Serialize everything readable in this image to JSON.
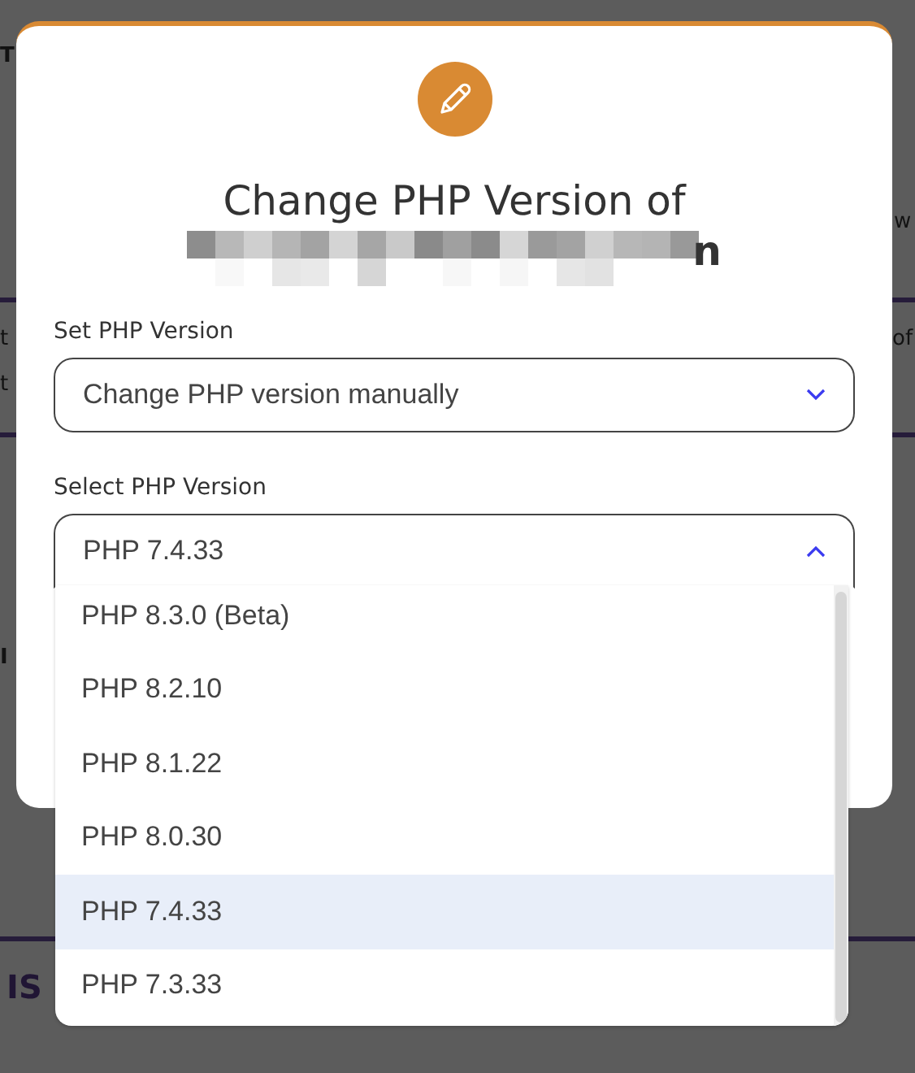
{
  "background": {
    "fragments": [
      {
        "text": "T",
        "kind": "heading"
      },
      {
        "text": "w",
        "kind": "body"
      },
      {
        "text": "t",
        "kind": "body"
      },
      {
        "text": "of",
        "kind": "body"
      },
      {
        "text": "t",
        "kind": "body"
      },
      {
        "text": "I",
        "kind": "heading"
      },
      {
        "text": "IS",
        "kind": "accent"
      }
    ]
  },
  "modal": {
    "title": "Change PHP Version of",
    "title_tail": "n",
    "fields": [
      {
        "label": "Set PHP Version",
        "value": "Change PHP version manually",
        "expanded": false
      },
      {
        "label": "Select PHP Version",
        "value": "PHP 7.4.33",
        "expanded": true,
        "options": [
          {
            "label": "PHP 8.3.0 (Beta)",
            "selected": false
          },
          {
            "label": "PHP 8.2.10",
            "selected": false
          },
          {
            "label": "PHP 8.1.22",
            "selected": false
          },
          {
            "label": "PHP 8.0.30",
            "selected": false
          },
          {
            "label": "PHP 7.4.33",
            "selected": true
          },
          {
            "label": "PHP 7.3.33",
            "selected": false
          }
        ]
      }
    ]
  }
}
